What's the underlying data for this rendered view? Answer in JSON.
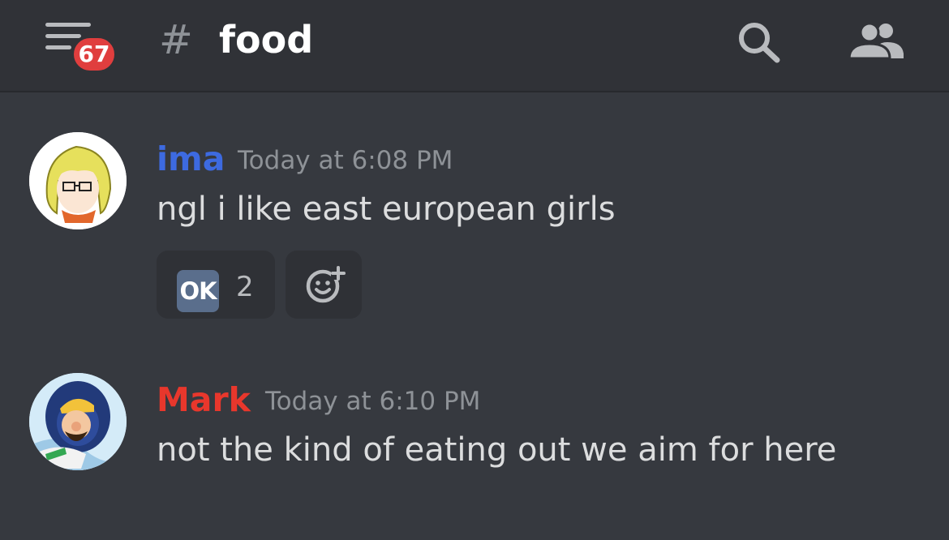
{
  "header": {
    "unread_count": "67",
    "channel_prefix": "#",
    "channel_name": "food",
    "icons": [
      "menu-icon",
      "search-icon",
      "members-icon"
    ]
  },
  "messages": [
    {
      "author": "ima",
      "author_color": "#3d6ae0",
      "timestamp": "Today at 6:08 PM",
      "text": "ngl i like east european girls",
      "reactions": [
        {
          "emoji": "OK",
          "emoji_name": "ok-button-emoji",
          "count": "2"
        }
      ],
      "add_reaction_icon": "add-reaction-icon"
    },
    {
      "author": "Mark",
      "author_color": "#e8372c",
      "timestamp": "Today at 6:10 PM",
      "text": "not the kind of eating out we aim for here"
    }
  ],
  "colors": {
    "background": "#36393f",
    "header": "#303237",
    "badge": "#e03e3e",
    "reaction_bg": "#2f3136"
  }
}
